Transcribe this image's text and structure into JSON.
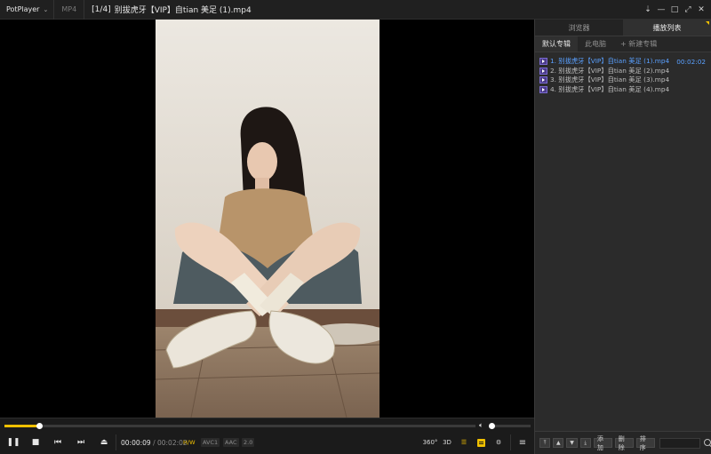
{
  "app": {
    "name": "PotPlayer",
    "format": "MP4",
    "title_index": "[1/4]",
    "title_file": "别拔虎牙【VIP】自tian 美足 (1).mp4"
  },
  "window_controls": [
    "pin-icon",
    "minimize-icon",
    "maximize-icon",
    "fullscreen-icon",
    "close-icon"
  ],
  "panel": {
    "tabs": [
      {
        "label": "浏览器",
        "active": false
      },
      {
        "label": "播放列表",
        "active": true
      }
    ],
    "subtabs": [
      {
        "label": "默认专辑",
        "active": true
      },
      {
        "label": "此电脑",
        "active": false
      },
      {
        "label": "+ 新建专辑",
        "active": false
      }
    ],
    "playlist": [
      {
        "label": "1. 别拔虎牙【VIP】自tian 美足 (1).mp4",
        "duration": "00:02:02",
        "active": true
      },
      {
        "label": "2. 别拔虎牙【VIP】自tian 美足 (2).mp4",
        "duration": "",
        "active": false
      },
      {
        "label": "3. 别拔虎牙【VIP】自tian 美足 (3).mp4",
        "duration": "",
        "active": false
      },
      {
        "label": "4. 别拔虎牙【VIP】自tian 美足 (4).mp4",
        "duration": "",
        "active": false
      }
    ],
    "bottom": {
      "add_label": "添加",
      "delete_label": "删除",
      "sort_label": "排序",
      "search_placeholder": ""
    }
  },
  "playback": {
    "elapsed": "00:00:09",
    "total": "/ 00:02:02",
    "progress_fraction": 0.0738,
    "volume_fraction": 0.04,
    "badges": {
      "hw": "H/W",
      "video": "AVC1",
      "audio": "AAC",
      "channels": "2.0"
    },
    "right_icons": {
      "vr": "360°",
      "threed": "3D"
    }
  },
  "colors": {
    "accent": "#f0c000",
    "playlist_active": "#5aa0ff",
    "background": "#1b1b1b"
  }
}
